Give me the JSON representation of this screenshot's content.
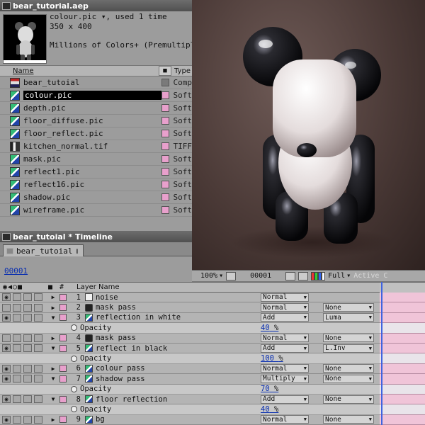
{
  "project": {
    "title": "bear_tutorial.aep",
    "preview": {
      "line1": "colour.pic ▾, used 1 time",
      "line2": "350 x 400",
      "line3": "Millions of Colors+ (Premultiplied"
    },
    "columns": {
      "name": "Name",
      "type": "Type"
    },
    "items": [
      {
        "name": "bear_tutoial",
        "type": "Comp",
        "kind": "comp"
      },
      {
        "name": "colour.pic",
        "type": "Soft",
        "kind": "pic",
        "selected": true
      },
      {
        "name": "depth.pic",
        "type": "Soft",
        "kind": "pic"
      },
      {
        "name": "floor_diffuse.pic",
        "type": "Soft",
        "kind": "pic"
      },
      {
        "name": "floor_reflect.pic",
        "type": "Soft",
        "kind": "pic"
      },
      {
        "name": "kitchen_normal.tif",
        "type": "TIFF",
        "kind": "tif"
      },
      {
        "name": "mask.pic",
        "type": "Soft",
        "kind": "pic"
      },
      {
        "name": "reflect1.pic",
        "type": "Soft",
        "kind": "pic"
      },
      {
        "name": "reflect16.pic",
        "type": "Soft",
        "kind": "pic"
      },
      {
        "name": "shadow.pic",
        "type": "Soft",
        "kind": "pic"
      },
      {
        "name": "wireframe.pic",
        "type": "Soft",
        "kind": "pic"
      }
    ]
  },
  "viewer": {
    "zoom": "100%",
    "timecode": "00001",
    "resolution": "Full",
    "active_camera": "Active C"
  },
  "timeline": {
    "title": "bear_tutoial * Timeline",
    "tab": "bear_tutoial",
    "current_time": "00001",
    "header": {
      "switches": "◉◀○■",
      "number": "#",
      "layer_name": "Layer Name"
    },
    "rows": [
      {
        "kind": "layer",
        "num": "1",
        "name": "noise",
        "thumb": "solid",
        "mode": "Normal",
        "trkmat": "",
        "eye": true,
        "open": false
      },
      {
        "kind": "layer",
        "num": "2",
        "name": "mask pass",
        "thumb": "mask",
        "mode": "Normal",
        "trkmat": "None",
        "eye": false,
        "open": false
      },
      {
        "kind": "layer",
        "num": "3",
        "name": "reflection in white",
        "thumb": "pic",
        "mode": "Add",
        "trkmat": "Luma",
        "eye": true,
        "open": true
      },
      {
        "kind": "prop",
        "name": "Opacity",
        "value": "40",
        "unit": "%"
      },
      {
        "kind": "layer",
        "num": "4",
        "name": "mask pass",
        "thumb": "mask",
        "mode": "Normal",
        "trkmat": "None",
        "eye": false,
        "open": false
      },
      {
        "kind": "layer",
        "num": "5",
        "name": "reflect in black",
        "thumb": "pic",
        "mode": "Add",
        "trkmat": "L.Inv",
        "eye": true,
        "open": true
      },
      {
        "kind": "prop",
        "name": "Opacity",
        "value": "100",
        "unit": "%"
      },
      {
        "kind": "layer",
        "num": "6",
        "name": "colour pass",
        "thumb": "pic",
        "mode": "Normal",
        "trkmat": "None",
        "eye": true,
        "open": false
      },
      {
        "kind": "layer",
        "num": "7",
        "name": "shadow pass",
        "thumb": "pic",
        "mode": "Multiply",
        "trkmat": "None",
        "eye": true,
        "open": true
      },
      {
        "kind": "prop",
        "name": "Opacity",
        "value": "70",
        "unit": "%"
      },
      {
        "kind": "layer",
        "num": "8",
        "name": "floor reflection",
        "thumb": "pic",
        "mode": "Add",
        "trkmat": "None",
        "eye": true,
        "open": true
      },
      {
        "kind": "prop",
        "name": "Opacity",
        "value": "40",
        "unit": "%"
      },
      {
        "kind": "layer",
        "num": "9",
        "name": "bg",
        "thumb": "pic",
        "mode": "Normal",
        "trkmat": "None",
        "eye": true,
        "open": false
      }
    ]
  },
  "colors": {
    "label_pink": "#e8a0cc",
    "value_blue": "#0a2fb0",
    "cti_blue": "#3f63e0",
    "track_pink": "#f0c4d8"
  }
}
